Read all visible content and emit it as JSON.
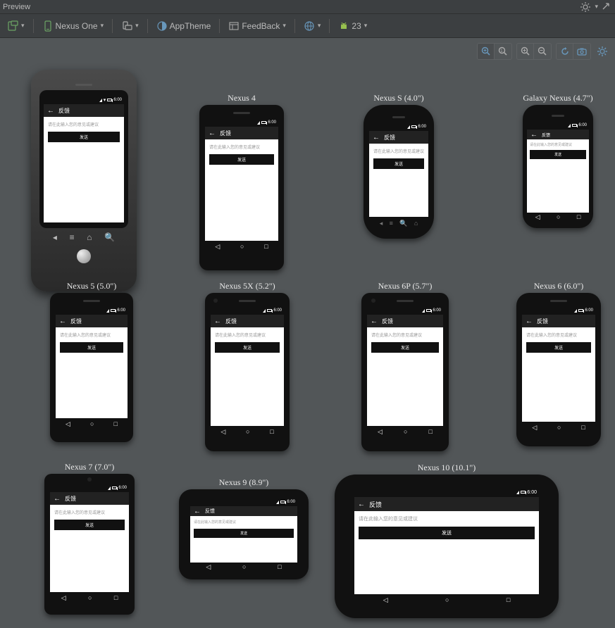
{
  "title": "Preview",
  "toolbar": {
    "device": "Nexus One",
    "theme_label": "AppTheme",
    "screen_label": "FeedBack",
    "api_label": "23"
  },
  "app": {
    "title": "反馈",
    "hint": "请在此输入您的意见或建议",
    "send": "发送",
    "time": "6:00"
  },
  "devices": {
    "nexus4": "Nexus 4",
    "nexusS": "Nexus S (4.0\")",
    "galaxyNexus": "Galaxy Nexus (4.7\")",
    "nexus5": "Nexus 5 (5.0\")",
    "nexus5x": "Nexus 5X (5.2\")",
    "nexus6p": "Nexus 6P (5.7\")",
    "nexus6": "Nexus 6 (6.0\")",
    "nexus7": "Nexus 7 (7.0\")",
    "nexus9": "Nexus 9 (8.9\")",
    "nexus10": "Nexus 10 (10.1\")"
  }
}
